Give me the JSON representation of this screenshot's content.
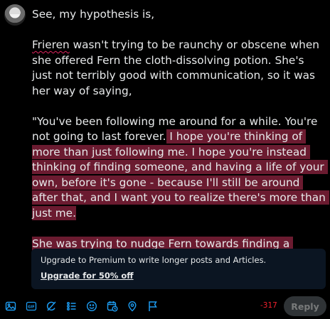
{
  "composer": {
    "p1": "See, my hypothesis is,",
    "p2_word": "Frieren",
    "p2_rest": " wasn't trying to be raunchy or obscene when she offered Fern the cloth-dissolving potion. She's just not terribly good with communication, so it was her way of saying,",
    "p3_plain": "\"You've been following me around for a while. You're not going to last forever.",
    "p3_highlight": " I hope you're thinking of more than just following me. I hope you're instead thinking of finding someone, and having a life of your own, before it's gone - because I'll still be around after that, and I want you to realize there's more than just me.",
    "p4_highlight": "She was trying to nudge Fern towards finding a significant other."
  },
  "premium": {
    "text": "Upgrade to Premium to write longer posts and Articles.",
    "link": "Upgrade for 50% off"
  },
  "toolbar": {
    "icons": [
      "image-icon",
      "gif-icon",
      "grok-icon",
      "list-icon",
      "emoji-icon",
      "schedule-icon",
      "location-icon",
      "flag-icon"
    ],
    "accent": "#1d9bf0"
  },
  "char_count": "-317",
  "reply_button": "Reply",
  "colors": {
    "highlight": "#6b1b30",
    "over_limit": "#f4212e"
  }
}
